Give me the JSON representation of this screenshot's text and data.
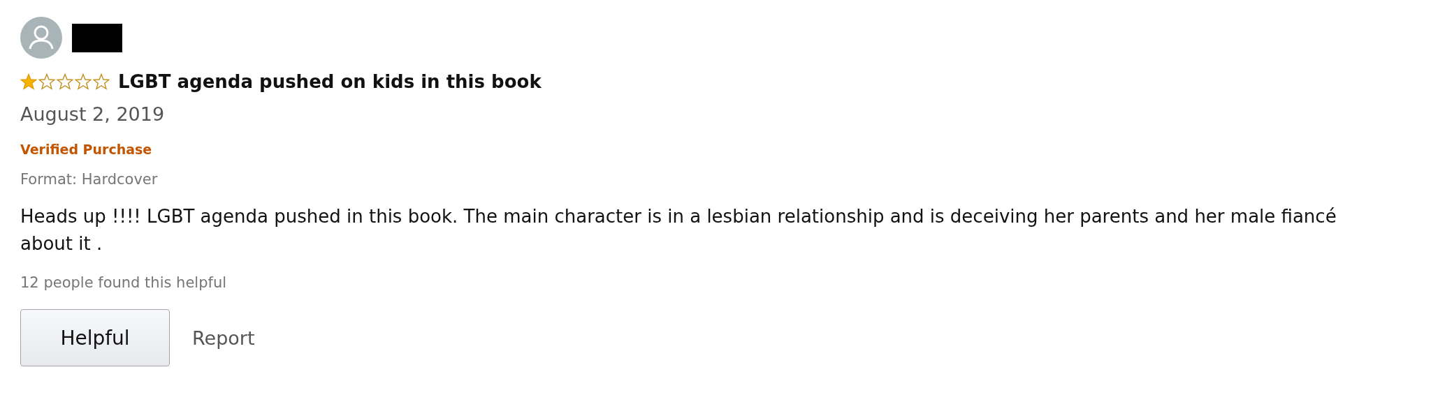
{
  "review": {
    "stars": 1,
    "title": "LGBT agenda pushed on kids in this book",
    "date": "August 2, 2019",
    "badge": "Verified Purchase",
    "format": "Format: Hardcover",
    "body": "Heads up !!!! LGBT agenda pushed in this book. The main character is in a lesbian relationship and is deceiving her parents and her male fiancé about it .",
    "helpful_count": "12 people found this helpful",
    "buttons": [
      "Helpful",
      "Report"
    ]
  }
}
